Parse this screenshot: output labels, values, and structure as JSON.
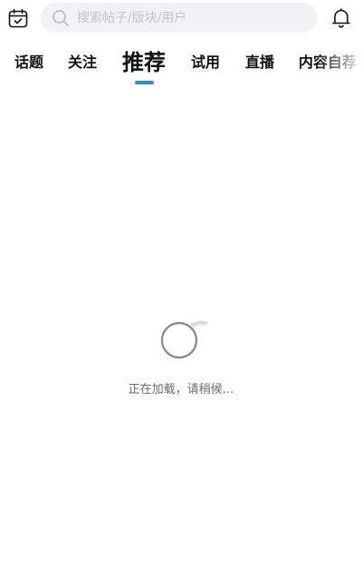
{
  "header": {
    "calendar_icon": "calendar-check-icon",
    "search": {
      "placeholder": "搜索帖子/版块/用户",
      "value": "",
      "icon": "search-icon"
    },
    "bell_icon": "bell-icon"
  },
  "tabs": {
    "items": [
      {
        "label": "话题"
      },
      {
        "label": "关注"
      },
      {
        "label": "推荐"
      },
      {
        "label": "试用"
      },
      {
        "label": "直播"
      },
      {
        "label": "内容自荐"
      }
    ],
    "active_index": 2,
    "indicator_color": "#2a8fe3"
  },
  "loading": {
    "text": "正在加载，请稍候..."
  }
}
